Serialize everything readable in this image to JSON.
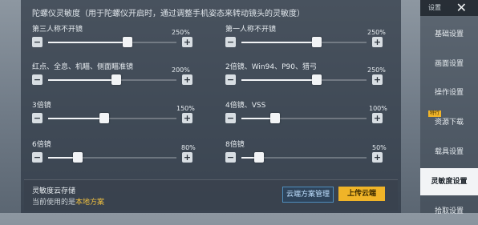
{
  "header": {
    "title": "陀螺仪灵敏度（用于陀螺仪开启时，通过调整手机姿态来转动镜头的灵敏度）"
  },
  "rows": [
    {
      "label": "第三人称不开镜",
      "value_text": "250%",
      "fraction": 0.62
    },
    {
      "label": "第一人称不开镜",
      "value_text": "250%",
      "fraction": 0.6
    },
    {
      "label": "红点、全息、机瞄、侧面瞄准镜",
      "value_text": "200%",
      "fraction": 0.53
    },
    {
      "label": "2倍镜、Win94、P90、猎弓",
      "value_text": "250%",
      "fraction": 0.6
    },
    {
      "label": "3倍镜",
      "value_text": "150%",
      "fraction": 0.44
    },
    {
      "label": "4倍镜、VSS",
      "value_text": "100%",
      "fraction": 0.27
    },
    {
      "label": "6倍镜",
      "value_text": "80%",
      "fraction": 0.23
    },
    {
      "label": "8倍镜",
      "value_text": "50%",
      "fraction": 0.14
    }
  ],
  "cloud": {
    "title": "灵敏度云存储",
    "sub_prefix": "当前使用的是",
    "sub_value": "本地方案",
    "manage_label": "云端方案管理",
    "upload_label": "上传云端"
  },
  "sidebar": {
    "head_label": "设置",
    "close_symbol": "✕",
    "items": [
      {
        "label": "基础设置"
      },
      {
        "label": "画面设置"
      },
      {
        "label": "操作设置"
      },
      {
        "label": "资源下载"
      },
      {
        "label": "载具设置"
      },
      {
        "label": "灵敏度设置"
      },
      {
        "label": "拾取设置"
      }
    ],
    "badge_label": "特行"
  },
  "colors": {
    "accent": "#f0b428",
    "highlight": "#f0c040",
    "active_tab_bg": "#f2f4f6"
  }
}
